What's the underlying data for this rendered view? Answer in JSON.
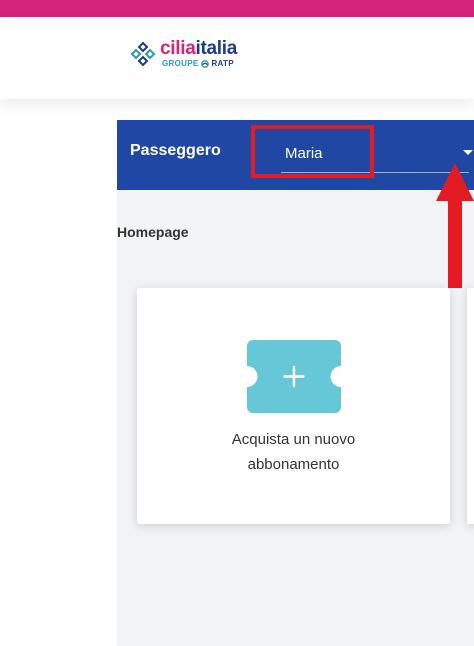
{
  "brand": {
    "name_part1": "cilia",
    "name_part2": "italia",
    "sub_part1": "GROUPE",
    "sub_part2": "RATP"
  },
  "colors": {
    "topbar": "#d6247a",
    "header_blue": "#1f47a3",
    "ticket": "#66c8d6",
    "annotation_red": "#e31b23"
  },
  "header_bar": {
    "passenger_label": "Passeggero",
    "passenger_value": "Maria"
  },
  "breadcrumb": "Homepage",
  "cards": [
    {
      "icon": "ticket-plus-icon",
      "label_line1": "Acquista un nuovo",
      "label_line2": "abbonamento"
    }
  ]
}
